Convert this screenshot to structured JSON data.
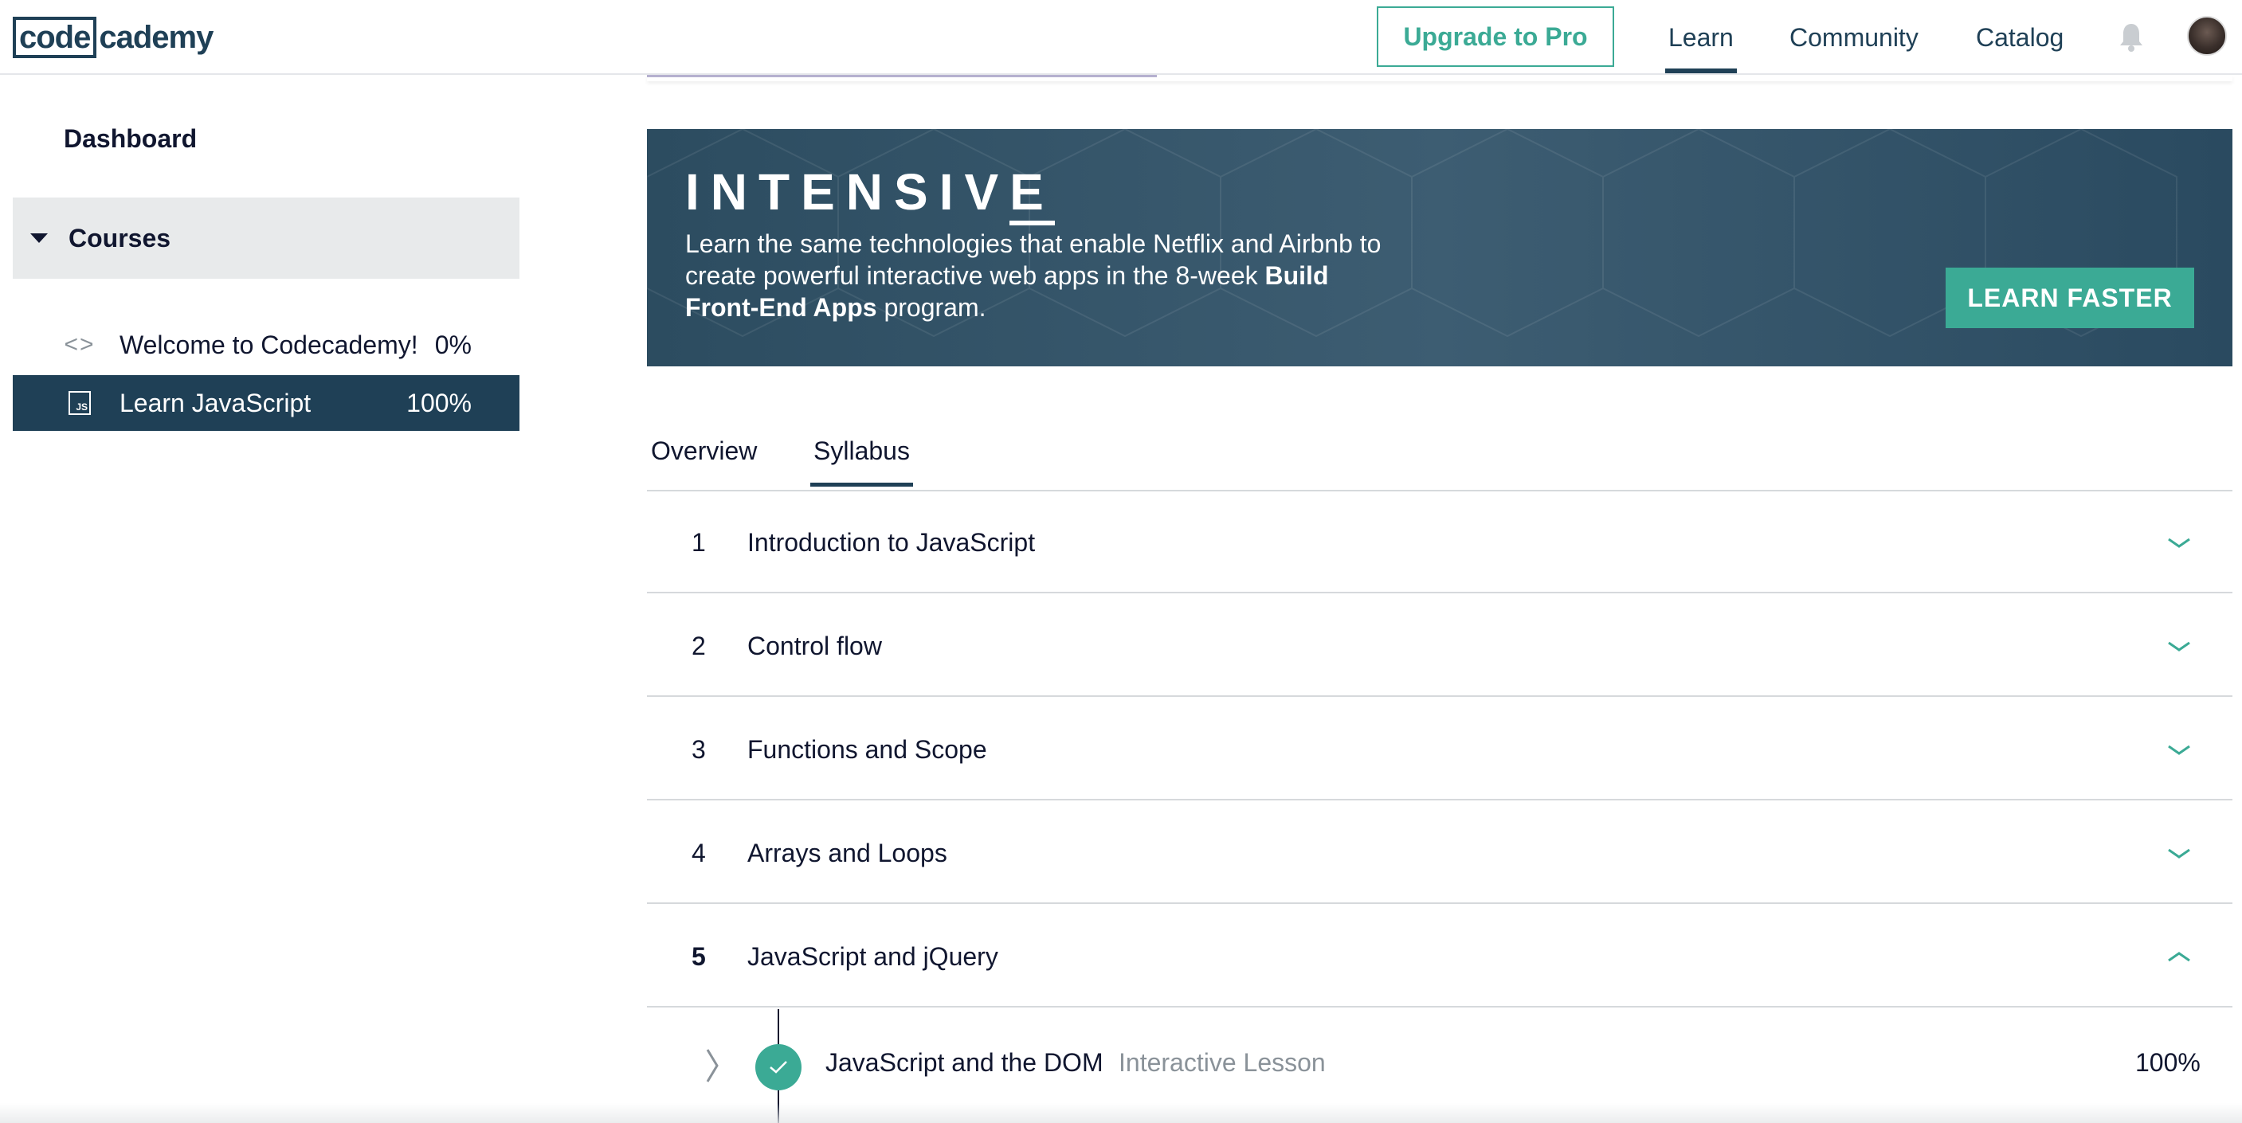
{
  "brand": {
    "logo_boxed": "code",
    "logo_rest": "cademy"
  },
  "topnav": {
    "upgrade_label": "Upgrade to Pro",
    "links": [
      {
        "label": "Learn",
        "active": true
      },
      {
        "label": "Community",
        "active": false
      },
      {
        "label": "Catalog",
        "active": false
      }
    ],
    "icons": [
      "bell-icon",
      "avatar"
    ]
  },
  "sidebar": {
    "dashboard_label": "Dashboard",
    "courses_label": "Courses",
    "courses": [
      {
        "icon": "code-brackets-icon",
        "icon_glyph": "<>",
        "label": "Welcome to Codecademy!",
        "progress": "0%",
        "active": false
      },
      {
        "icon": "js-file-icon",
        "icon_glyph": "JS",
        "label": "Learn JavaScript",
        "progress": "100%",
        "active": true
      }
    ]
  },
  "banner": {
    "title_main": "INTENSIV",
    "title_last": "E",
    "text_before": "Learn the same technologies that enable Netflix and Airbnb to create powerful interactive web apps in the 8-week ",
    "text_bold": "Build Front-End Apps",
    "text_after": " program.",
    "cta_label": "LEARN FASTER"
  },
  "tabs": [
    {
      "label": "Overview",
      "active": false
    },
    {
      "label": "Syllabus",
      "active": true
    }
  ],
  "syllabus": [
    {
      "number": "1",
      "title": "Introduction to JavaScript",
      "expanded": false
    },
    {
      "number": "2",
      "title": "Control flow",
      "expanded": false
    },
    {
      "number": "3",
      "title": "Functions and Scope",
      "expanded": false
    },
    {
      "number": "4",
      "title": "Arrays and Loops",
      "expanded": false
    },
    {
      "number": "5",
      "title": "JavaScript and jQuery",
      "expanded": true
    }
  ],
  "lesson": {
    "title": "JavaScript and the DOM",
    "type": "Interactive Lesson",
    "progress": "100%",
    "completed": true
  },
  "colors": {
    "navy": "#1f4056",
    "accent_teal": "#3baa95",
    "text": "#10162f",
    "muted": "#8a9299"
  }
}
